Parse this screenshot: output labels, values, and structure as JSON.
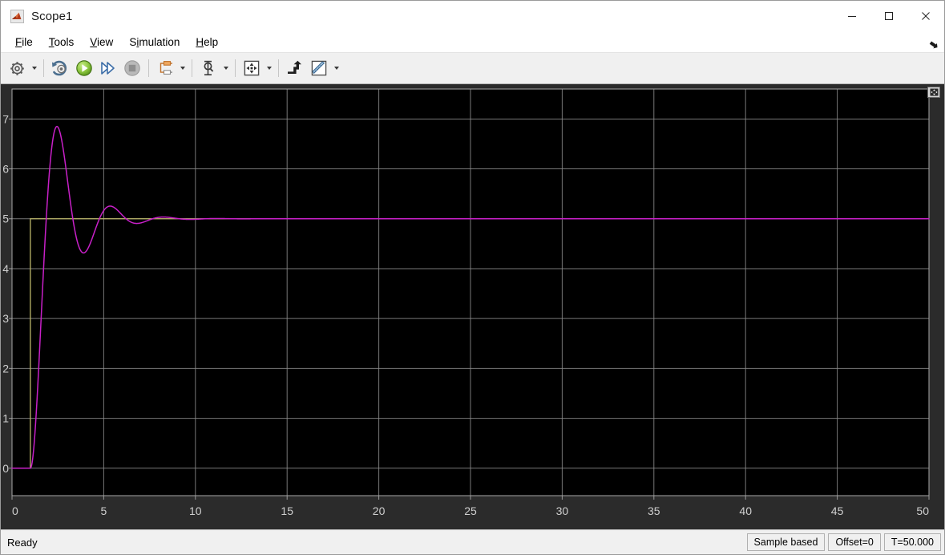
{
  "window": {
    "title": "Scope1",
    "app_icon": "matlab-membrane-icon",
    "controls": {
      "minimize": "─",
      "maximize": "□",
      "close": "✕"
    }
  },
  "menubar": {
    "items": [
      {
        "label": "File",
        "mnemonic": "F",
        "rest": "ile"
      },
      {
        "label": "Tools",
        "mnemonic": "T",
        "rest": "ools"
      },
      {
        "label": "View",
        "mnemonic": "V",
        "rest": "iew"
      },
      {
        "label": "Simulation",
        "pre": "S",
        "mnemonic": "i",
        "rest": "mulation"
      },
      {
        "label": "Help",
        "mnemonic": "H",
        "rest": "elp"
      }
    ],
    "expand_icon": "menu-expand-arrow-icon"
  },
  "toolbar": {
    "buttons": [
      {
        "name": "configuration-properties-button",
        "icon": "gear-icon",
        "enabled": true,
        "has_dropdown": true
      },
      {
        "name": "rewind-to-start-button",
        "icon": "rewind-icon",
        "enabled": true,
        "has_dropdown": false
      },
      {
        "name": "run-button",
        "icon": "play-icon",
        "enabled": true,
        "has_dropdown": false
      },
      {
        "name": "step-forward-button",
        "icon": "step-forward-icon",
        "enabled": true,
        "has_dropdown": false
      },
      {
        "name": "stop-button",
        "icon": "stop-icon",
        "enabled": false,
        "has_dropdown": false
      },
      {
        "name": "signal-selection-button",
        "icon": "signal-selector-icon",
        "enabled": true,
        "has_dropdown": true
      },
      {
        "name": "cursor-measurements-button",
        "icon": "cursor-icon",
        "enabled": true,
        "has_dropdown": true
      },
      {
        "name": "zoom-fit-to-view-button",
        "icon": "fit-to-view-icon",
        "enabled": true,
        "has_dropdown": true
      },
      {
        "name": "trigger-button",
        "icon": "trigger-icon",
        "enabled": true,
        "has_dropdown": false
      },
      {
        "name": "measurements-button",
        "icon": "ruler-icon",
        "enabled": true,
        "has_dropdown": true
      }
    ]
  },
  "plot": {
    "axes_maximize_icon": "maximize-axes-icon",
    "background": "#000000",
    "frame_background": "#2b2b2b",
    "grid_color": "#8c8c8c",
    "tick_label_color": "#cfcfcf"
  },
  "statusbar": {
    "ready_text": "Ready",
    "cells": [
      {
        "name": "sample-mode-cell",
        "text": "Sample based"
      },
      {
        "name": "offset-cell",
        "text": "Offset=0"
      },
      {
        "name": "time-cell",
        "text": "T=50.000"
      }
    ]
  },
  "chart_data": {
    "type": "line",
    "title": "",
    "xlabel": "",
    "ylabel": "",
    "xlim": [
      0,
      50
    ],
    "ylim": [
      -0.55,
      7.6
    ],
    "xticks": [
      0,
      5,
      10,
      15,
      20,
      25,
      30,
      35,
      40,
      45,
      50
    ],
    "xticklabels": [
      "0",
      "5",
      "10",
      "15",
      "20",
      "25",
      "30",
      "35",
      "40",
      "45",
      "50"
    ],
    "yticks": [
      0,
      1,
      2,
      3,
      4,
      5,
      6,
      7
    ],
    "yticklabels": [
      "0",
      "1",
      "2",
      "3",
      "4",
      "5",
      "6",
      "7"
    ],
    "grid": true,
    "legend": "none",
    "series": [
      {
        "name": "step-reference",
        "color": "#bdb76b",
        "step_time": 1,
        "initial_value": 0,
        "final_value": 5,
        "description": "Step reference input, rises from 0 to 5 at t = 1 s"
      },
      {
        "name": "system-response",
        "color": "#c820c8",
        "description": "Underdamped second-order step response settling to 5",
        "step_time": 1,
        "steady_state": 5,
        "first_peak_value": 6.85,
        "first_peak_time": 3.1,
        "first_trough_value": 3.72,
        "first_trough_time": 4.8,
        "second_peak_value": 5.93,
        "second_peak_time": 6.0,
        "second_trough_value": 4.33,
        "second_trough_time": 7.5,
        "third_peak_value": 5.5,
        "third_peak_time": 8.7,
        "overshoot_percent": 37,
        "damped_period": 2.9,
        "damping_decay_rate": 0.52
      }
    ]
  }
}
